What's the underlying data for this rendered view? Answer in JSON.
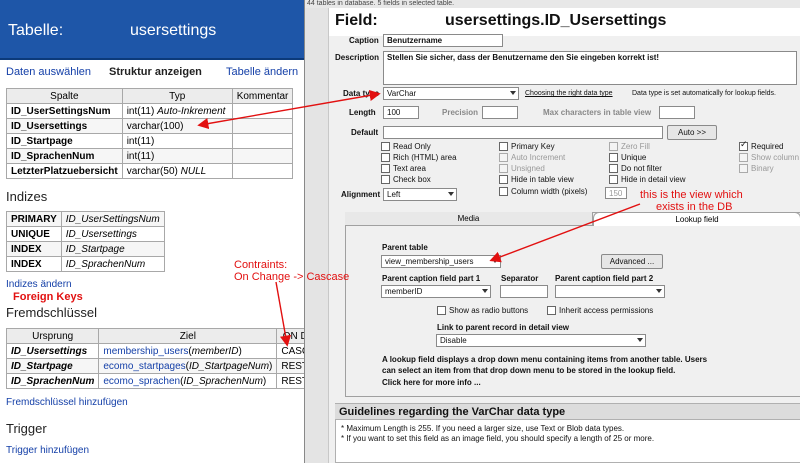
{
  "left": {
    "header_label": "Tabelle:",
    "header_table": "usersettings",
    "nav": [
      "Daten auswählen",
      "Struktur anzeigen",
      "Tabelle ändern"
    ],
    "structure_headers": [
      "Spalte",
      "Typ",
      "Kommentar"
    ],
    "structure_rows": [
      {
        "name": "ID_UserSettingsNum",
        "type": "int(11)",
        "extra": "Auto-Inkrement"
      },
      {
        "name": "ID_Usersettings",
        "type": "varchar(100)",
        "extra": ""
      },
      {
        "name": "ID_Startpage",
        "type": "int(11)",
        "extra": ""
      },
      {
        "name": "ID_SprachenNum",
        "type": "int(11)",
        "extra": ""
      },
      {
        "name": "LetzterPlatzuebersicht",
        "type": "varchar(50)",
        "extra": "NULL"
      }
    ],
    "indizes_title": "Indizes",
    "indizes_rows": [
      {
        "kind": "PRIMARY",
        "col": "ID_UserSettingsNum"
      },
      {
        "kind": "UNIQUE",
        "col": "ID_Usersettings"
      },
      {
        "kind": "INDEX",
        "col": "ID_Startpage"
      },
      {
        "kind": "INDEX",
        "col": "ID_SprachenNum"
      }
    ],
    "indizes_link": "Indizes ändern",
    "foreign_annotation": "Foreign Keys",
    "fk_title": "Fremdschlüssel",
    "fk_headers": [
      "Ursprung",
      "Ziel",
      "ON D"
    ],
    "fk_rows": [
      {
        "src": "ID_Usersettings",
        "target": "membership_users",
        "target_col": "memberID",
        "on": "CASC"
      },
      {
        "src": "ID_Startpage",
        "target": "ecomo_startpages",
        "target_col": "ID_StartpageNum",
        "on": "REST"
      },
      {
        "src": "ID_SprachenNum",
        "target": "ecomo_sprachen",
        "target_col": "ID_SprachenNum",
        "on": "REST"
      }
    ],
    "fk_link": "Fremdschlüssel hinzufügen",
    "trigger_title": "Trigger",
    "trigger_link": "Trigger hinzufügen"
  },
  "annotations": {
    "constraints_line1": "Contraints:",
    "constraints_line2": "On Change -> Cascase",
    "view_line1": "this is the view which",
    "view_line2": "exists in the DB"
  },
  "right": {
    "topline": "44 tables in database. 5 fields in selected table.",
    "field_label": "Field:",
    "field_name": "usersettings.ID_Usersettings",
    "caption_label": "Caption",
    "caption_value": "Benutzername",
    "description_label": "Description",
    "description_value": "Stellen Sie sicher, dass der Benutzername den Sie eingeben korrekt ist!",
    "datatype_label": "Data type",
    "datatype_value": "VarChar",
    "datatype_link": "Choosing the right data type",
    "datatype_note": "Data type is set automatically for lookup fields.",
    "length_label": "Length",
    "length_value": "100",
    "precision_label": "Precision",
    "maxchars_label": "Max characters in table view",
    "default_label": "Default",
    "auto_button": "Auto >>",
    "checkboxes": [
      {
        "label": "Read Only",
        "checked": false,
        "disabled": false
      },
      {
        "label": "Primary Key",
        "checked": false,
        "disabled": false
      },
      {
        "label": "Zero Fill",
        "checked": false,
        "disabled": true
      },
      {
        "label": "Required",
        "checked": true,
        "disabled": false
      },
      {
        "label": "Rich (HTML) area",
        "checked": false,
        "disabled": false
      },
      {
        "label": "Auto Increment",
        "checked": false,
        "disabled": true
      },
      {
        "label": "Unique",
        "checked": false,
        "disabled": false
      },
      {
        "label": "Show column",
        "checked": false,
        "disabled": true
      },
      {
        "label": "Text area",
        "checked": false,
        "disabled": false
      },
      {
        "label": "Unsigned",
        "checked": false,
        "disabled": true
      },
      {
        "label": "Do not filter",
        "checked": false,
        "disabled": false
      },
      {
        "label": "Binary",
        "checked": false,
        "disabled": true
      },
      {
        "label": "Check box",
        "checked": false,
        "disabled": false
      },
      {
        "label": "Hide in table view",
        "checked": false,
        "disabled": false
      },
      {
        "label": "Hide in detail view",
        "checked": false,
        "disabled": false
      },
      {
        "label": "Column width (pixels)",
        "checked": false,
        "disabled": false
      }
    ],
    "column_width_value": "150",
    "alignment_label": "Alignment",
    "alignment_value": "Left",
    "tab_media": "Media",
    "tab_lookup": "Lookup field",
    "parent_table_label": "Parent table",
    "parent_table_value": "view_membership_users",
    "advanced_button": "Advanced ...",
    "parent_caption1_label": "Parent caption field part 1",
    "parent_caption1_value": "memberID",
    "separator_label": "Separator",
    "parent_caption2_label": "Parent caption field part 2",
    "radio_label": "Show as radio buttons",
    "inherit_label": "Inherit access permissions",
    "link_label": "Link to parent record in detail view",
    "link_value": "Disable",
    "lookup_desc1": "A lookup field displays a drop down menu containing items from another table. Users",
    "lookup_desc2": "can select an item from that drop down menu to be stored in the lookup field.",
    "lookup_more": "Click here for more info ...",
    "guide_title": "Guidelines regarding the VarChar data type",
    "guide_lines": [
      "* Maximum Length is 255. If you need a larger size, use Text or Blob data types.",
      "* If you want to set this field as an image field, you should specify a length of 25 or more."
    ]
  },
  "colors": {
    "header_blue": "#1e56a8",
    "link_blue": "#1540a8",
    "annotation_red": "#e21010"
  }
}
